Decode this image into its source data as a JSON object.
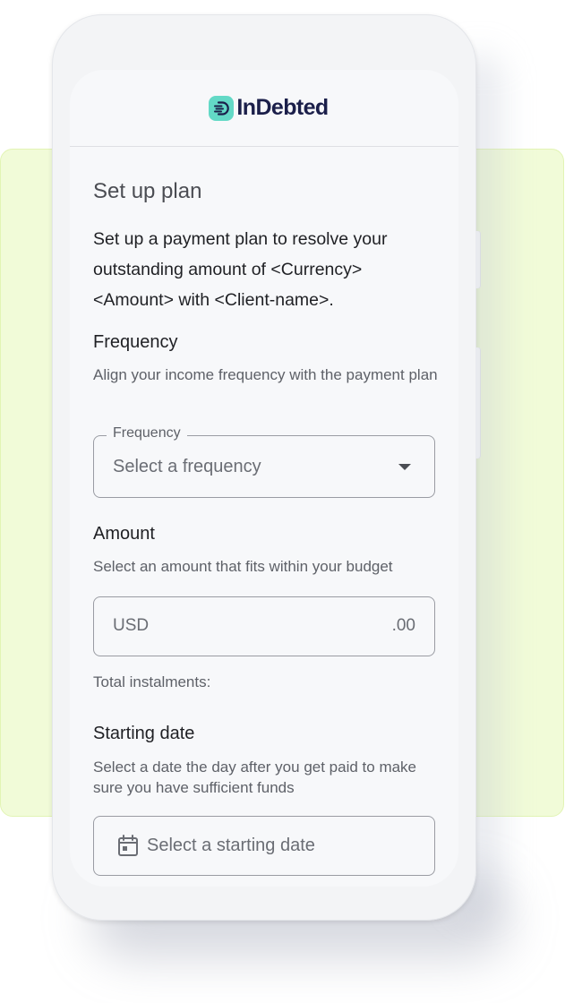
{
  "app": {
    "logo_text": "InDebted",
    "logo_icon": "indebted-logo-mark-icon",
    "brand_colors": {
      "accent": "#63d9c6",
      "text": "#1b1f4a",
      "background_highlight": "#f1fbd8"
    }
  },
  "page": {
    "title": "Set up plan",
    "lead": "Set up a payment plan to resolve your outstanding amount of <Currency> <Amount> with <Client-name>."
  },
  "frequency": {
    "title": "Frequency",
    "description": "Align your income frequency with the payment plan",
    "field_label": "Frequency",
    "placeholder": "Select a frequency",
    "icon": "chevron-down-icon"
  },
  "amount": {
    "title": "Amount",
    "description": "Select an amount that fits within your budget",
    "currency": "USD",
    "decimals": ".00",
    "totals_label": "Total instalments:"
  },
  "starting_date": {
    "title": "Starting date",
    "description": "Select a date the day after you get paid to make sure you have sufficient funds",
    "placeholder": "Select a starting date",
    "icon": "calendar-icon"
  }
}
